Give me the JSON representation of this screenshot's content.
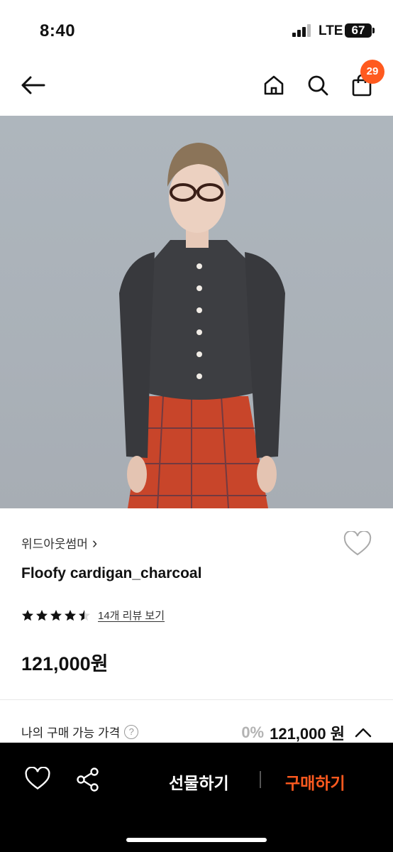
{
  "status_bar": {
    "time": "8:40",
    "network": "LTE",
    "battery": "67"
  },
  "nav": {
    "back_icon": "arrow-left-icon",
    "home_icon": "home-icon",
    "search_icon": "search-icon",
    "cart_icon": "shopping-bag-icon",
    "cart_count": "29",
    "badge_color": "#ff5a1f"
  },
  "product": {
    "brand": "위드아웃썸머",
    "brand_chevron": "›",
    "name": "Floofy cardigan_charcoal",
    "rating_stars": 4.5,
    "review_link": "14개 리뷰 보기",
    "price": "121,000원"
  },
  "my_price": {
    "label": "나의 구매 가능 가격",
    "help": "?",
    "discount": "0%",
    "value": "121,000 원"
  },
  "bottom_bar": {
    "gift_label": "선물하기",
    "buy_label": "구매하기",
    "buy_color": "#ff5a1f",
    "like_icon": "heart-icon",
    "share_icon": "share-icon"
  }
}
